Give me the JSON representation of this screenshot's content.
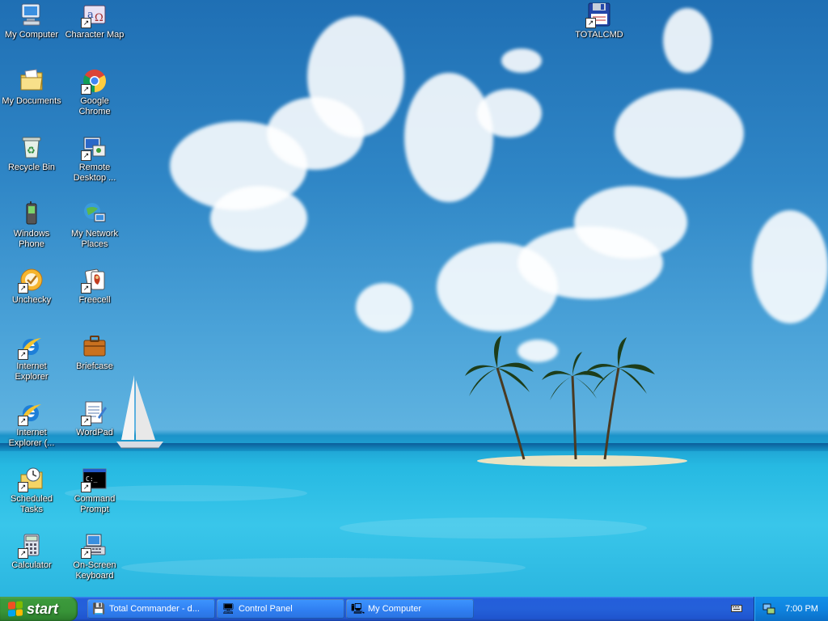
{
  "desktop_icons": [
    {
      "id": "my-computer",
      "label": "My Computer",
      "icon": "computer-icon",
      "shortcut": false
    },
    {
      "id": "character-map",
      "label": "Character Map",
      "icon": "character-map-icon",
      "shortcut": true
    },
    {
      "id": "my-documents",
      "label": "My Documents",
      "icon": "folder-documents-icon",
      "shortcut": false
    },
    {
      "id": "google-chrome",
      "label": "Google Chrome",
      "icon": "chrome-icon",
      "shortcut": true
    },
    {
      "id": "recycle-bin",
      "label": "Recycle Bin",
      "icon": "recycle-bin-icon",
      "shortcut": false
    },
    {
      "id": "remote-desktop",
      "label": "Remote Desktop ...",
      "icon": "remote-desktop-icon",
      "shortcut": true
    },
    {
      "id": "windows-phone",
      "label": "Windows Phone",
      "icon": "phone-icon",
      "shortcut": false
    },
    {
      "id": "my-network-places",
      "label": "My Network Places",
      "icon": "network-icon",
      "shortcut": false
    },
    {
      "id": "unchecky",
      "label": "Unchecky",
      "icon": "unchecky-icon",
      "shortcut": true
    },
    {
      "id": "freecell",
      "label": "Freecell",
      "icon": "cards-icon",
      "shortcut": true
    },
    {
      "id": "internet-explorer",
      "label": "Internet Explorer",
      "icon": "ie-icon",
      "shortcut": true
    },
    {
      "id": "briefcase",
      "label": "Briefcase",
      "icon": "briefcase-icon",
      "shortcut": false
    },
    {
      "id": "internet-explorer-2",
      "label": "Internet Explorer (...",
      "icon": "ie-icon",
      "shortcut": true
    },
    {
      "id": "wordpad",
      "label": "WordPad",
      "icon": "wordpad-icon",
      "shortcut": true
    },
    {
      "id": "scheduled-tasks",
      "label": "Scheduled Tasks",
      "icon": "scheduled-tasks-icon",
      "shortcut": true
    },
    {
      "id": "command-prompt",
      "label": "Command Prompt",
      "icon": "cmd-icon",
      "shortcut": true
    },
    {
      "id": "calculator",
      "label": "Calculator",
      "icon": "calculator-icon",
      "shortcut": true
    },
    {
      "id": "on-screen-keyboard",
      "label": "On-Screen Keyboard",
      "icon": "keyboard-icon",
      "shortcut": true
    },
    {
      "id": "totalcmd",
      "label": "TOTALCMD",
      "icon": "floppy-icon",
      "shortcut": true
    }
  ],
  "taskbar": {
    "start_label": "start",
    "tasks": [
      {
        "label": "Total Commander - d...",
        "icon": "totalcmd-icon"
      },
      {
        "label": "Control Panel",
        "icon": "control-panel-icon"
      },
      {
        "label": "My Computer",
        "icon": "computer-icon"
      }
    ],
    "clock": "7:00 PM",
    "tray_icons": [
      "keyboard-icon",
      "network-icon"
    ]
  },
  "colors": {
    "taskbar": "#245edb",
    "start_button": "#389438",
    "tray": "#0f84e0"
  }
}
